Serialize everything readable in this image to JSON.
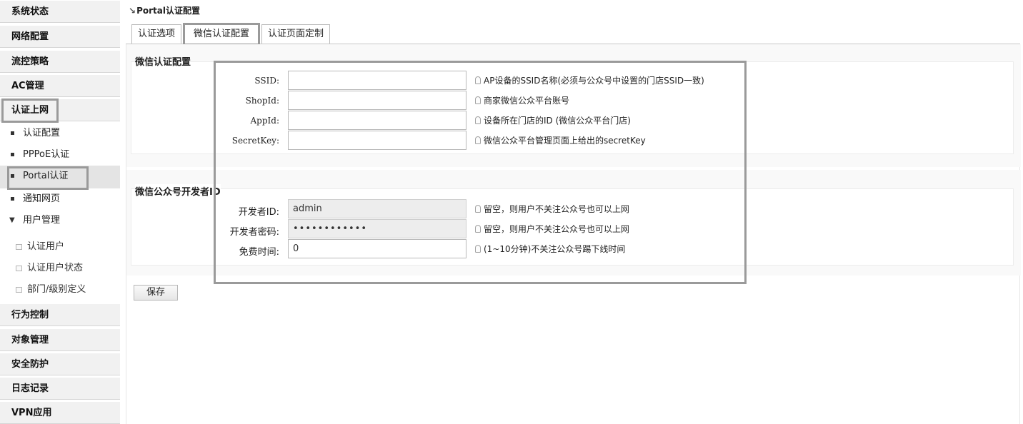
{
  "sidebar": {
    "menus": {
      "system_status": "系统状态",
      "network_config": "网络配置",
      "flow_policy": "流控策略",
      "ac_manage": "AC管理",
      "auth_online": "认证上网",
      "behavior_control": "行为控制",
      "object_manage": "对象管理",
      "security": "安全防护",
      "log": "日志记录",
      "vpn": "VPN应用"
    },
    "auth_items": {
      "auth_config": "认证配置",
      "pppoe": "PPPoE认证",
      "portal": "Portal认证",
      "notify": "通知网页",
      "user_manage": "用户管理"
    },
    "user_sub_items": {
      "auth_users": "认证用户",
      "auth_user_status": "认证用户状态",
      "dept_level": "部门/级别定义"
    }
  },
  "page": {
    "title": "Portal认证配置",
    "tabs": [
      "认证选项",
      "微信认证配置",
      "认证页面定制"
    ],
    "active_tab": "微信认证配置"
  },
  "wechat_section": {
    "title": "微信认证配置",
    "fields": [
      {
        "label": "SSID:",
        "value": "",
        "hint": "AP设备的SSID名称(必须与公众号中设置的门店SSID一致)"
      },
      {
        "label": "ShopId:",
        "value": "",
        "hint": "商家微信公众平台账号"
      },
      {
        "label": "AppId:",
        "value": "",
        "hint": "设备所在门店的ID (微信公众平台门店)"
      },
      {
        "label": "SecretKey:",
        "value": "",
        "hint": "微信公众平台管理页面上给出的secretKey"
      }
    ]
  },
  "developer_section": {
    "title": "微信公众号开发者ID",
    "fields": [
      {
        "label": "开发者ID:",
        "value": "admin",
        "hint": "留空，则用户不关注公众号也可以上网"
      },
      {
        "label": "开发者密码:",
        "value": "••••••••••••",
        "hint": "留空，则用户不关注公众号也可以上网"
      },
      {
        "label": "免费时间:",
        "value": "0",
        "hint": "(1~10分钟)不关注公众号踢下线时间"
      }
    ]
  },
  "buttons": {
    "save": "保存"
  }
}
